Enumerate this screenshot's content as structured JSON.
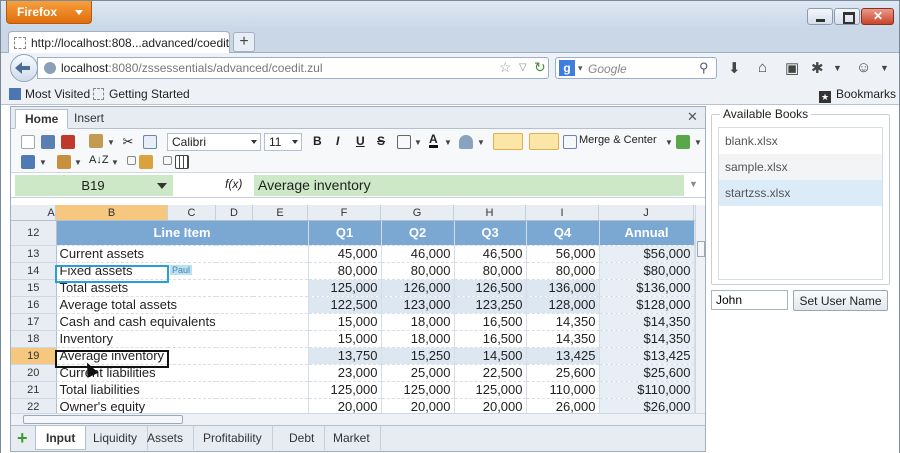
{
  "browser": {
    "menu_button": "Firefox",
    "tab_title": "http://localhost:808...advanced/coedit.zul",
    "url_host": "localhost",
    "url_rest": ":8080/zssessentials/advanced/coedit.zul",
    "search_placeholder": "Google",
    "bookmarks": [
      "Most Visited",
      "Getting Started"
    ],
    "bookmarks_menu": "Bookmarks"
  },
  "ribbon": {
    "tabs": [
      "Home",
      "Insert"
    ],
    "font": "Calibri",
    "size": "11",
    "merge_label": "Merge & Center"
  },
  "formula_bar": {
    "cell_ref": "B19",
    "fx_label": "f(x)",
    "value": "Average inventory"
  },
  "columns": [
    "A",
    "B",
    "C",
    "D",
    "E",
    "F",
    "G",
    "H",
    "I",
    "J"
  ],
  "header_row": {
    "num": "12",
    "label": "Line Item",
    "q": [
      "Q1",
      "Q2",
      "Q3",
      "Q4"
    ],
    "annual": "Annual"
  },
  "rows": [
    {
      "num": "13",
      "label": "Current assets",
      "q": [
        "45,000",
        "46,000",
        "46,500",
        "56,000"
      ],
      "annual": "$56,000"
    },
    {
      "num": "14",
      "label": "Fixed assets",
      "q": [
        "80,000",
        "80,000",
        "80,000",
        "80,000"
      ],
      "annual": "$80,000"
    },
    {
      "num": "15",
      "label": "Total assets",
      "q": [
        "125,000",
        "126,000",
        "126,500",
        "136,000"
      ],
      "annual": "$136,000"
    },
    {
      "num": "16",
      "label": "Average total assets",
      "q": [
        "122,500",
        "123,000",
        "123,250",
        "128,000"
      ],
      "annual": "$128,000"
    },
    {
      "num": "17",
      "label": "Cash and cash equivalents",
      "q": [
        "15,000",
        "18,000",
        "16,500",
        "14,350"
      ],
      "annual": "$14,350"
    },
    {
      "num": "18",
      "label": "Inventory",
      "q": [
        "15,000",
        "18,000",
        "16,500",
        "14,350"
      ],
      "annual": "$14,350"
    },
    {
      "num": "19",
      "label": "Average inventory",
      "q": [
        "13,750",
        "15,250",
        "14,500",
        "13,425"
      ],
      "annual": "$13,425"
    },
    {
      "num": "20",
      "label": "Current liabilities",
      "q": [
        "23,000",
        "25,000",
        "22,500",
        "25,600"
      ],
      "annual": "$25,600"
    },
    {
      "num": "21",
      "label": "Total liabilities",
      "q": [
        "125,000",
        "125,000",
        "125,000",
        "110,000"
      ],
      "annual": "$110,000"
    },
    {
      "num": "22",
      "label": "Owner's equity",
      "q": [
        "20,000",
        "20,000",
        "20,000",
        "26,000"
      ],
      "annual": "$26,000"
    }
  ],
  "collaborator_tag": "Paul",
  "sheet_tabs": [
    "Input",
    "Liquidity",
    "Assets",
    "Profitability",
    "Debt",
    "Market"
  ],
  "active_sheet": "Input",
  "side_panel": {
    "legend": "Available Books",
    "books": [
      "blank.xlsx",
      "sample.xlsx",
      "startzss.xlsx"
    ],
    "username_value": "John",
    "set_button": "Set User Name"
  },
  "colors": {
    "header_blue": "#7ba7d3",
    "highlight_green": "#cce8c6",
    "selection_orange": "#f6c87f",
    "collaborator_blue": "#28a0d7"
  },
  "icons": [
    "new-file-icon",
    "save-icon",
    "pdf-icon",
    "paste-icon",
    "cut-icon",
    "copy-icon",
    "bold-icon",
    "italic-icon",
    "underline-icon",
    "strikethrough-icon",
    "border-icon",
    "font-color-icon",
    "fill-color-icon",
    "align-vertical-icon",
    "align-horizontal-icon",
    "wrap-icon",
    "insert-icon",
    "clear-icon",
    "format-painter-icon",
    "sort-icon",
    "lock-icon",
    "grid-icon"
  ]
}
